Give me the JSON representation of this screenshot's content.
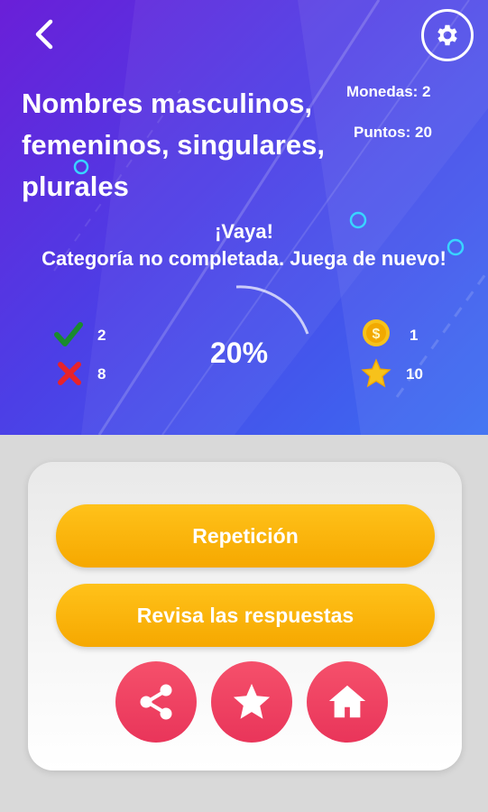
{
  "header": {
    "back_icon": "chevron-left-icon",
    "settings_icon": "gear-icon"
  },
  "quiz": {
    "title": "Nombres masculinos, femeninos, singulares, plurales",
    "coins_label": "Monedas: 2",
    "points_label": "Puntos: 20"
  },
  "result": {
    "line1": "¡Vaya!",
    "line2": "Categoría no completada. Juega de nuevo!",
    "percent": "20%",
    "progress_fraction": 0.2
  },
  "stats": {
    "correct": "2",
    "wrong": "8",
    "coins": "1",
    "stars": "10"
  },
  "actions": {
    "replay_label": "Repetición",
    "review_label": "Revisa las respuestas"
  },
  "colors": {
    "accent_yellow": "#f6a800",
    "accent_pink": "#e9355a",
    "hero_start": "#6a1fd8",
    "hero_end": "#3a6ff2"
  }
}
